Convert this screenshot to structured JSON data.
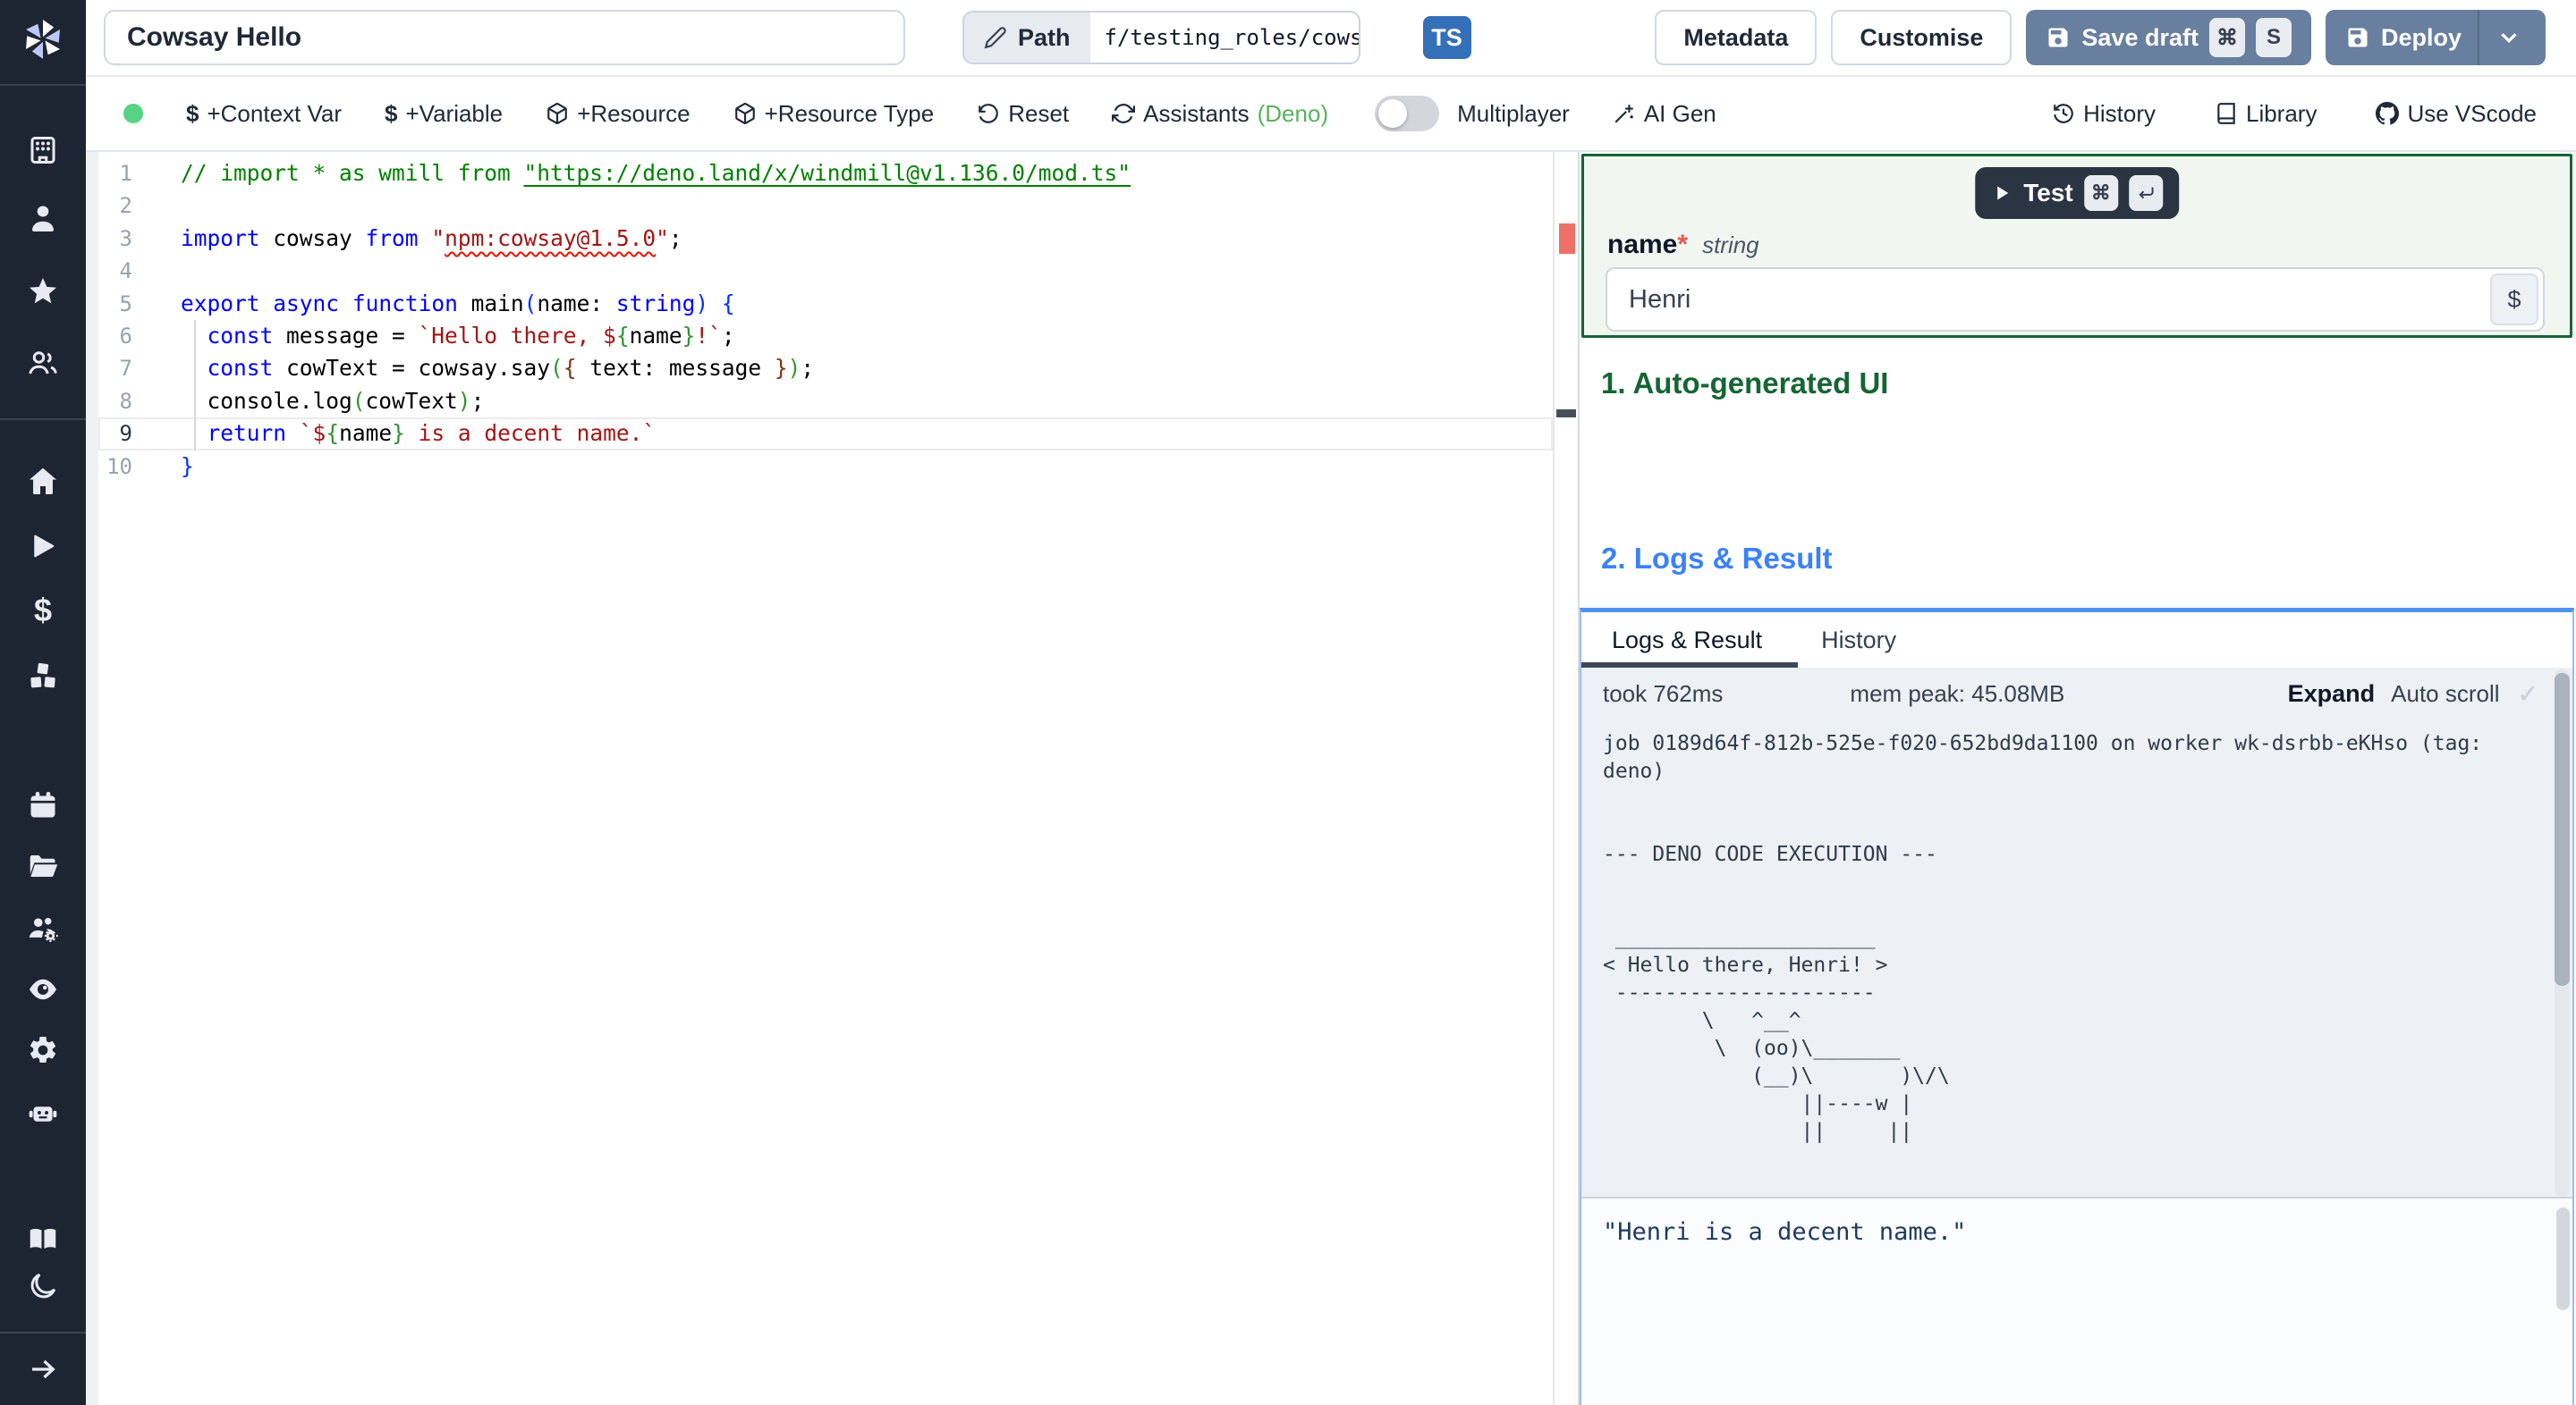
{
  "topbar": {
    "title_value": "Cowsay Hello",
    "path_label": "Path",
    "path_value": "f/testing_roles/cowsa",
    "language_badge": "TS",
    "metadata_label": "Metadata",
    "customise_label": "Customise",
    "save_draft_label": "Save draft",
    "save_shortcut": [
      "⌘",
      "S"
    ],
    "deploy_label": "Deploy"
  },
  "toolbar": {
    "context_var_label": "+Context Var",
    "variable_label": "+Variable",
    "resource_label": "+Resource",
    "resource_type_label": "+Resource Type",
    "reset_label": "Reset",
    "assistants_label": "Assistants",
    "assistants_suffix": "(Deno)",
    "multiplayer_label": "Multiplayer",
    "ai_gen_label": "AI Gen",
    "history_label": "History",
    "library_label": "Library",
    "vscode_label": "Use VScode",
    "dollar_glyph": "$"
  },
  "editor": {
    "active_line": 9,
    "lines": [
      [
        [
          "cm",
          "// import * as wmill from "
        ],
        [
          "cl",
          "\"https://deno.land/x/windmill@v1.136.0/mod.ts\""
        ]
      ],
      [],
      [
        [
          "kw",
          "import"
        ],
        [
          "pl",
          " cowsay "
        ],
        [
          "kw",
          "from"
        ],
        [
          "pl",
          " "
        ],
        [
          "str",
          "\""
        ],
        [
          "strw",
          "npm:cowsay@1.5.0"
        ],
        [
          "str",
          "\""
        ],
        [
          "pl",
          ";"
        ]
      ],
      [],
      [
        [
          "kw",
          "export"
        ],
        [
          "pl",
          " "
        ],
        [
          "kw",
          "async"
        ],
        [
          "pl",
          " "
        ],
        [
          "kw",
          "function"
        ],
        [
          "pl",
          " main"
        ],
        [
          "b1",
          "("
        ],
        [
          "pl",
          "name: "
        ],
        [
          "kw",
          "string"
        ],
        [
          "b1",
          ")"
        ],
        [
          "pl",
          " "
        ],
        [
          "b1",
          "{"
        ]
      ],
      [
        [
          "pl",
          "  "
        ],
        [
          "kw",
          "const"
        ],
        [
          "pl",
          " message = "
        ],
        [
          "str",
          "`Hello there, $"
        ],
        [
          "b2",
          "{"
        ],
        [
          "pl",
          "name"
        ],
        [
          "b2",
          "}"
        ],
        [
          "str",
          "!`"
        ],
        [
          "pl",
          ";"
        ]
      ],
      [
        [
          "pl",
          "  "
        ],
        [
          "kw",
          "const"
        ],
        [
          "pl",
          " cowText = cowsay.say"
        ],
        [
          "b2",
          "("
        ],
        [
          "b3",
          "{"
        ],
        [
          "pl",
          " text: message "
        ],
        [
          "b3",
          "}"
        ],
        [
          "b2",
          ")"
        ],
        [
          "pl",
          ";"
        ]
      ],
      [
        [
          "pl",
          "  console.log"
        ],
        [
          "b2",
          "("
        ],
        [
          "pl",
          "cowText"
        ],
        [
          "b2",
          ")"
        ],
        [
          "pl",
          ";"
        ]
      ],
      [
        [
          "pl",
          "  "
        ],
        [
          "kw",
          "return"
        ],
        [
          "pl",
          " "
        ],
        [
          "str",
          "`$"
        ],
        [
          "b2",
          "{"
        ],
        [
          "pl",
          "name"
        ],
        [
          "b2",
          "}"
        ],
        [
          "str",
          " is a decent name.`"
        ]
      ],
      [
        [
          "b1",
          "}"
        ]
      ]
    ]
  },
  "runner": {
    "test_label": "Test",
    "test_shortcut_cmd": "⌘",
    "arg_name": "name",
    "required_marker": "*",
    "arg_type": "string",
    "arg_value": "Henri",
    "var_picker_label": "$",
    "section_1_title": "1. Auto-generated UI",
    "section_2_title": "2. Logs & Result",
    "tab_logs": "Logs & Result",
    "tab_history": "History",
    "took_label": "took 762ms",
    "mem_label": "mem peak: 45.08MB",
    "expand_label": "Expand",
    "autoscroll_label": "Auto scroll",
    "autoscroll_check": "✓",
    "log_lines": [
      "job 0189d64f-812b-525e-f020-652bd9da1100 on worker wk-dsrbb-eKHso (tag:",
      "deno)",
      "",
      "",
      "--- DENO CODE EXECUTION ---",
      "",
      "",
      " _____________________",
      "< Hello there, Henri! >",
      " ---------------------",
      "        \\   ^__^",
      "         \\  (oo)\\_______",
      "            (__)\\       )\\/\\",
      "                ||----w |",
      "                ||     ||"
    ],
    "result_value": "\"Henri is a decent name.\""
  },
  "sidebar": {
    "icon_names": [
      "windmill-logo",
      "building-icon",
      "user-icon",
      "star-icon",
      "users-icon",
      "home-icon",
      "play-icon",
      "dollar-icon",
      "cubes-icon",
      "calendar-icon",
      "folder-icon",
      "users-gear-icon",
      "eye-icon",
      "gear-icon",
      "robot-icon",
      "book-icon",
      "moon-icon",
      "arrow-right-icon"
    ]
  },
  "colors": {
    "sidebar_bg": "#1e2532",
    "primary_button": "#697f9f",
    "ts_badge": "#3470b8",
    "success_green": "#166534",
    "heading_blue": "#3b82f6",
    "deno_green": "#57b25f",
    "status_dot": "#56d483",
    "error_red": "#e8574f",
    "logs_border_blue": "#4f93f0"
  }
}
